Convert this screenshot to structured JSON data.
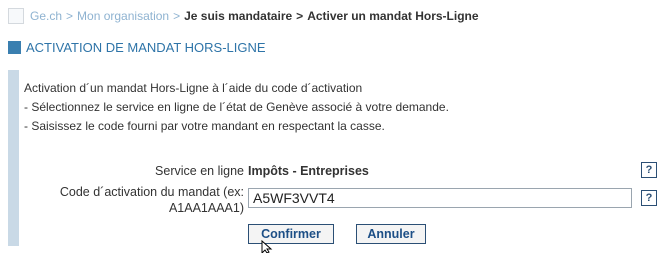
{
  "breadcrumb": {
    "items": [
      "Ge.ch",
      "Mon organisation"
    ],
    "separator": ">",
    "tail": [
      "Je suis mandataire",
      "Activer un mandat Hors-Ligne"
    ]
  },
  "section": {
    "title": "ACTIVATION DE MANDAT HORS-LIGNE"
  },
  "instructions": {
    "heading": "Activation d´un mandat Hors-Ligne à l´aide du code d´activation",
    "lines": [
      " - Sélectionnez le service en ligne de l´état de Genève associé à votre demande.",
      " - Saisissez le code fourni par votre mandant en respectant la casse."
    ]
  },
  "form": {
    "service_label": "Service en ligne",
    "service_value": "Impôts - Entreprises",
    "code_label_line1": "Code d´activation du mandat (ex:",
    "code_label_line2": "A1AA1AAA1)",
    "code_value": "A5WF3VVT4",
    "help_label": "?"
  },
  "buttons": {
    "confirm": "Confirmer",
    "cancel": "Annuler"
  },
  "colors": {
    "link": "#8fb3d1",
    "title": "#2e74a8",
    "accent_square": "#3a7fb0",
    "panel_bar": "#c9d9e6",
    "button_text": "#1d4f86"
  }
}
